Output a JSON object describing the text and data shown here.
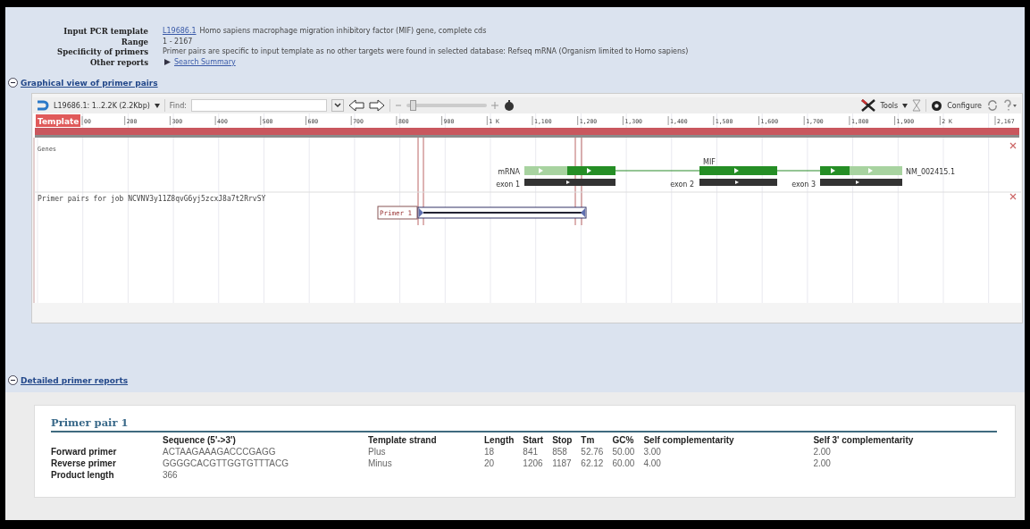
{
  "summary": [
    {
      "label": "Input PCR template",
      "kind": "link-text",
      "link": "L19686.1",
      "text": "Homo sapiens macrophage migration inhibitory factor (MIF) gene, complete cds"
    },
    {
      "label": "Range",
      "kind": "text",
      "text": "1 - 2167"
    },
    {
      "label": "Specificity of primers",
      "kind": "text",
      "text": "Primer pairs are specific to input template as no other targets were found in selected database: Refseq mRNA (Organism limited to Homo sapiens)"
    },
    {
      "label": "Other reports",
      "kind": "arrow-link",
      "link": "Search Summary"
    }
  ],
  "graphical_section": {
    "title": "Graphical view of primer pairs",
    "expanded": true
  },
  "viewer": {
    "sequence_menu": "L19686.1: 1..2.2K (2.2Kbp)",
    "find_label": "Find:",
    "zoom": {
      "level": 0.05
    },
    "tools": "Tools",
    "configure": "Configure",
    "ruler": {
      "label": "Template",
      "ticks": [
        "00",
        "200",
        "300",
        "400",
        "500",
        "600",
        "700",
        "800",
        "900",
        "1 K",
        "1,100",
        "1,200",
        "1,300",
        "1,400",
        "1,500",
        "1,600",
        "1,700",
        "1,800",
        "1,900",
        "2 K",
        "2,167"
      ]
    },
    "genes_track": {
      "title": "Genes",
      "gene": "MIF",
      "mrna_label": "mRNA",
      "accession": "NM_002415.1",
      "exons": [
        "exon 1",
        "exon 2",
        "exon 3"
      ]
    },
    "primer_track": {
      "title": "Primer pairs for job NCVNV3y11Z8qvG6yj5zcxJ8a7t2RrvSY",
      "primer": "Primer 1"
    }
  },
  "report_section": {
    "title": "Detailed primer reports",
    "expanded": true
  },
  "report": {
    "title": "Primer pair 1",
    "columns": [
      "Sequence (5'->3')",
      "Template strand",
      "Length",
      "Start",
      "Stop",
      "Tm",
      "GC%",
      "Self complementarity",
      "Self 3' complementarity"
    ],
    "rows": [
      {
        "label": "Forward primer",
        "cells": [
          "ACTAAGAAAGACCCGAGG",
          "Plus",
          "18",
          "841",
          "858",
          "52.76",
          "50.00",
          "3.00",
          "2.00"
        ]
      },
      {
        "label": "Reverse primer",
        "cells": [
          "GGGGCACGTTGGTGTTTACG",
          "Minus",
          "20",
          "1206",
          "1187",
          "62.12",
          "60.00",
          "4.00",
          "2.00"
        ]
      },
      {
        "label": "Product length",
        "cells": [
          "366"
        ]
      }
    ]
  }
}
